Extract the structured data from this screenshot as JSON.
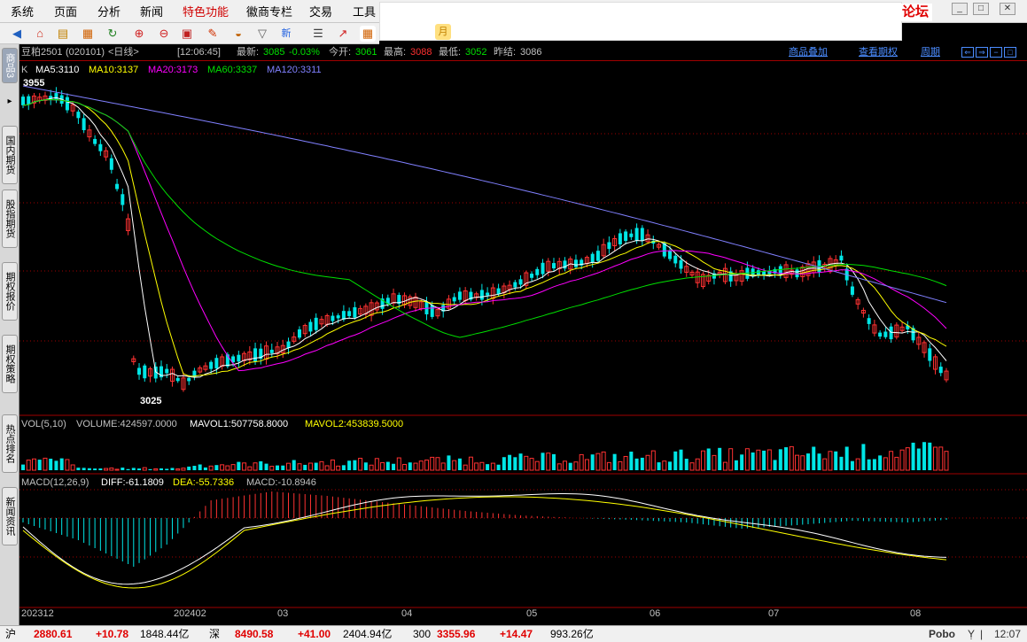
{
  "menubar": {
    "items": [
      "系统",
      "页面",
      "分析",
      "新闻",
      "特色功能",
      "徽商专栏",
      "交易",
      "工具"
    ],
    "forum": "论坛"
  },
  "toolbar": {
    "icons": [
      "back-icon",
      "home-icon",
      "stack-icon",
      "grid-icon",
      "refresh-icon",
      "zoom-in-icon",
      "zoom-out-icon",
      "window-icon",
      "pencil-icon",
      "dish-icon",
      "funnel-icon",
      "new-icon",
      "table-icon",
      "chart-up-icon",
      "calendar-icon"
    ],
    "new_label": "新",
    "month_label": "月"
  },
  "sidetabs": [
    "商品",
    "国内期货",
    "股指期货",
    "期权报价",
    "期权策略",
    "热点排名",
    "新闻资讯"
  ],
  "sidetab_top_suffix": "3",
  "info": {
    "symbol": "豆粕2501",
    "code": "(020101)",
    "period": "<日线>",
    "time": "[12:06:45]",
    "latest_label": "最新:",
    "latest": "3085",
    "change": "-0.03%",
    "open_label": "今开:",
    "open": "3061",
    "high_label": "最高:",
    "high": "3088",
    "low_label": "最低:",
    "low": "3052",
    "prev_label": "昨结:",
    "prev": "3086",
    "link_overlay": "商品叠加",
    "link_options": "查看期权",
    "link_period": "周期"
  },
  "ma_legend": {
    "k": "K",
    "ma5": "MA5:3110",
    "ma10": "MA10:3137",
    "ma20": "MA20:3173",
    "ma60": "MA60:3337",
    "ma120": "MA120:3311"
  },
  "price_marks": {
    "high": "3955",
    "low": "3025"
  },
  "volume_legend": {
    "name": "VOL(5,10)",
    "volume": "VOLUME:424597.0000",
    "mavol1": "MAVOL1:507758.8000",
    "mavol2": "MAVOL2:453839.5000"
  },
  "macd_legend": {
    "name": "MACD(12,26,9)",
    "diff": "DIFF:-61.1809",
    "dea": "DEA:-55.7336",
    "macd": "MACD:-10.8946"
  },
  "xaxis": [
    "202312",
    "202402",
    "03",
    "04",
    "05",
    "06",
    "07",
    "08"
  ],
  "statusbar": {
    "sh_label": "沪",
    "sh_value": "2880.61",
    "sh_change": "+10.78",
    "sh_amount": "1848.44亿",
    "sz_label": "深",
    "sz_value": "8490.58",
    "sz_change": "+41.00",
    "sz_amount": "2404.94亿",
    "idx300_label": "300",
    "idx300_value": "3355.96",
    "idx300_change": "+14.47",
    "idx300_amount": "993.26亿",
    "brand": "Pobo",
    "clock": "12:07"
  },
  "colors": {
    "up": "#ff3232",
    "down": "#00e6e6",
    "ma5": "#ffffff",
    "ma10": "#ffff00",
    "ma20": "#ff00ff",
    "ma60": "#00e000",
    "ma120": "#8080ff",
    "grid": "#a00000"
  }
}
